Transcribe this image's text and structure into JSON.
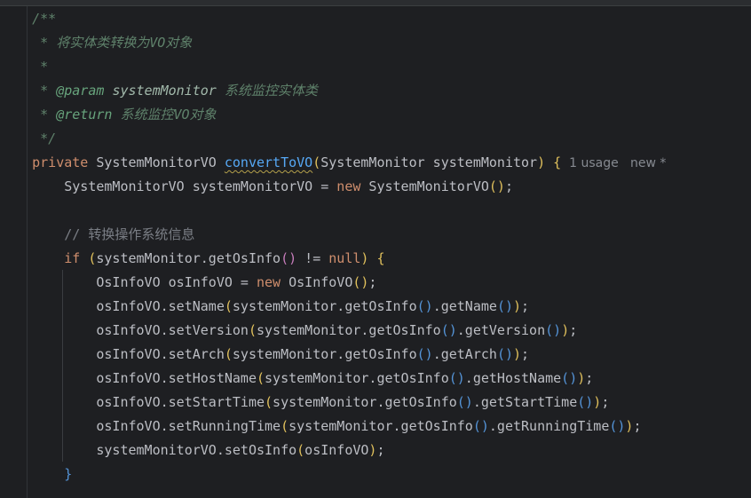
{
  "code_lines": [
    [
      {
        "t": "    /**",
        "c": "doc"
      }
    ],
    [
      {
        "t": "     * 将实体类转换为VO对象",
        "c": "doc"
      }
    ],
    [
      {
        "t": "     *",
        "c": "doc"
      }
    ],
    [
      {
        "t": "     * ",
        "c": "doc"
      },
      {
        "t": "@param",
        "c": "doc-tag"
      },
      {
        "t": " ",
        "c": "doc"
      },
      {
        "t": "systemMonitor",
        "c": "doc-param"
      },
      {
        "t": " 系统监控实体类",
        "c": "doc"
      }
    ],
    [
      {
        "t": "     * ",
        "c": "doc"
      },
      {
        "t": "@return",
        "c": "doc-tag"
      },
      {
        "t": " 系统监控VO对象",
        "c": "doc"
      }
    ],
    [
      {
        "t": "     */",
        "c": "doc"
      }
    ],
    [
      {
        "t": "    ",
        "c": "plain"
      },
      {
        "t": "private",
        "c": "kw"
      },
      {
        "t": " SystemMonitorVO ",
        "c": "plain"
      },
      {
        "t": "convertToVO",
        "c": "fn-usage"
      },
      {
        "t": "(",
        "c": "paren-y"
      },
      {
        "t": "SystemMonitor systemMonitor",
        "c": "plain"
      },
      {
        "t": ")",
        "c": "paren-y"
      },
      {
        "t": " ",
        "c": "plain"
      },
      {
        "t": "{",
        "c": "paren-y"
      },
      {
        "t": "  1 usage   new *",
        "c": "hint"
      }
    ],
    [
      {
        "t": "        SystemMonitorVO systemMonitorVO = ",
        "c": "plain"
      },
      {
        "t": "new",
        "c": "kw"
      },
      {
        "t": " SystemMonitorVO",
        "c": "plain"
      },
      {
        "t": "()",
        "c": "paren-y"
      },
      {
        "t": ";",
        "c": "plain"
      }
    ],
    [
      {
        "t": "",
        "c": "plain"
      }
    ],
    [
      {
        "t": "        // 转换操作系统信息",
        "c": "comment"
      }
    ],
    [
      {
        "t": "        ",
        "c": "plain"
      },
      {
        "t": "if",
        "c": "kw"
      },
      {
        "t": " ",
        "c": "plain"
      },
      {
        "t": "(",
        "c": "paren-y"
      },
      {
        "t": "systemMonitor.getOsInfo",
        "c": "plain"
      },
      {
        "t": "()",
        "c": "paren-p"
      },
      {
        "t": " != ",
        "c": "plain"
      },
      {
        "t": "null",
        "c": "kw"
      },
      {
        "t": ")",
        "c": "paren-y"
      },
      {
        "t": " ",
        "c": "plain"
      },
      {
        "t": "{",
        "c": "paren-y"
      }
    ],
    [
      {
        "t": "            OsInfoVO osInfoVO = ",
        "c": "plain"
      },
      {
        "t": "new",
        "c": "kw"
      },
      {
        "t": " OsInfoVO",
        "c": "plain"
      },
      {
        "t": "()",
        "c": "paren-y"
      },
      {
        "t": ";",
        "c": "plain"
      }
    ],
    [
      {
        "t": "            osInfoVO.setName",
        "c": "plain"
      },
      {
        "t": "(",
        "c": "paren-y"
      },
      {
        "t": "systemMonitor.getOsInfo",
        "c": "plain"
      },
      {
        "t": "()",
        "c": "paren-b"
      },
      {
        "t": ".getName",
        "c": "plain"
      },
      {
        "t": "()",
        "c": "paren-b"
      },
      {
        "t": ")",
        "c": "paren-y"
      },
      {
        "t": ";",
        "c": "plain"
      }
    ],
    [
      {
        "t": "            osInfoVO.setVersion",
        "c": "plain"
      },
      {
        "t": "(",
        "c": "paren-y"
      },
      {
        "t": "systemMonitor.getOsInfo",
        "c": "plain"
      },
      {
        "t": "()",
        "c": "paren-b"
      },
      {
        "t": ".getVersion",
        "c": "plain"
      },
      {
        "t": "()",
        "c": "paren-b"
      },
      {
        "t": ")",
        "c": "paren-y"
      },
      {
        "t": ";",
        "c": "plain"
      }
    ],
    [
      {
        "t": "            osInfoVO.setArch",
        "c": "plain"
      },
      {
        "t": "(",
        "c": "paren-y"
      },
      {
        "t": "systemMonitor.getOsInfo",
        "c": "plain"
      },
      {
        "t": "()",
        "c": "paren-b"
      },
      {
        "t": ".getArch",
        "c": "plain"
      },
      {
        "t": "()",
        "c": "paren-b"
      },
      {
        "t": ")",
        "c": "paren-y"
      },
      {
        "t": ";",
        "c": "plain"
      }
    ],
    [
      {
        "t": "            osInfoVO.setHostName",
        "c": "plain"
      },
      {
        "t": "(",
        "c": "paren-y"
      },
      {
        "t": "systemMonitor.getOsInfo",
        "c": "plain"
      },
      {
        "t": "()",
        "c": "paren-b"
      },
      {
        "t": ".getHostName",
        "c": "plain"
      },
      {
        "t": "()",
        "c": "paren-b"
      },
      {
        "t": ")",
        "c": "paren-y"
      },
      {
        "t": ";",
        "c": "plain"
      }
    ],
    [
      {
        "t": "            osInfoVO.setStartTime",
        "c": "plain"
      },
      {
        "t": "(",
        "c": "paren-y"
      },
      {
        "t": "systemMonitor.getOsInfo",
        "c": "plain"
      },
      {
        "t": "()",
        "c": "paren-b"
      },
      {
        "t": ".getStartTime",
        "c": "plain"
      },
      {
        "t": "()",
        "c": "paren-b"
      },
      {
        "t": ")",
        "c": "paren-y"
      },
      {
        "t": ";",
        "c": "plain"
      }
    ],
    [
      {
        "t": "            osInfoVO.setRunningTime",
        "c": "plain"
      },
      {
        "t": "(",
        "c": "paren-y"
      },
      {
        "t": "systemMonitor.getOsInfo",
        "c": "plain"
      },
      {
        "t": "()",
        "c": "paren-b"
      },
      {
        "t": ".getRunningTime",
        "c": "plain"
      },
      {
        "t": "()",
        "c": "paren-b"
      },
      {
        "t": ")",
        "c": "paren-y"
      },
      {
        "t": ";",
        "c": "plain"
      }
    ],
    [
      {
        "t": "            systemMonitorVO.setOsInfo",
        "c": "plain"
      },
      {
        "t": "(",
        "c": "paren-y"
      },
      {
        "t": "osInfoVO",
        "c": "plain"
      },
      {
        "t": ")",
        "c": "paren-y"
      },
      {
        "t": ";",
        "c": "plain"
      }
    ],
    [
      {
        "t": "        ",
        "c": "plain"
      },
      {
        "t": "}",
        "c": "paren-b"
      }
    ]
  ]
}
